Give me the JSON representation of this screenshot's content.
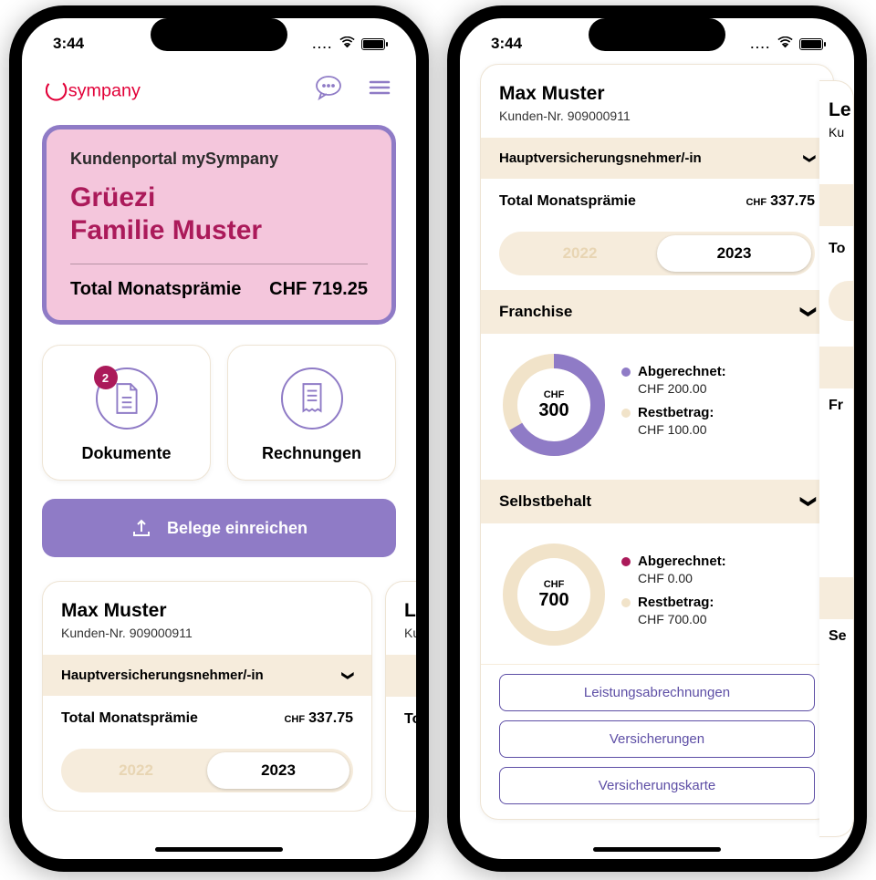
{
  "colors": {
    "violet": "#8f7bc6",
    "cream": "#f1e3c9",
    "wine": "#ab1a5a"
  },
  "status": {
    "time": "3:44",
    "dots": "...."
  },
  "brand": "sympany",
  "hero": {
    "portal": "Kundenportal mySympany",
    "greet1": "Grüezi",
    "greet2": "Familie Muster",
    "premium_label": "Total Monatsprämie",
    "premium_value": "CHF 719.25"
  },
  "tiles": {
    "docs": {
      "label": "Dokumente",
      "badge": "2"
    },
    "bills": {
      "label": "Rechnungen"
    }
  },
  "submit_label": "Belege einreichen",
  "member": {
    "name": "Max Muster",
    "customer_no_label": "Kunden-Nr. 909000911",
    "role": "Hauptversicherungsnehmer/-in",
    "premium_label": "Total Monatsprämie",
    "premium_currency": "CHF",
    "premium_value": "337.75",
    "years": {
      "prev": "2022",
      "current": "2023"
    }
  },
  "peek": {
    "name": "Le",
    "no": "Ku",
    "prem": "To"
  },
  "franchise": {
    "title": "Franchise",
    "currency": "CHF",
    "total": "300",
    "settled_label": "Abgerechnet:",
    "settled_value": "CHF 200.00",
    "rest_label": "Restbetrag:",
    "rest_value": "CHF 100.00"
  },
  "deductible": {
    "title": "Selbstbehalt",
    "currency": "CHF",
    "total": "700",
    "settled_label": "Abgerechnet:",
    "settled_value": "CHF 0.00",
    "rest_label": "Restbetrag:",
    "rest_value": "CHF 700.00"
  },
  "buttons": {
    "b1": "Leistungsabrechnungen",
    "b2": "Versicherungen",
    "b3": "Versicherungskarte"
  },
  "peek2": {
    "name": "Le",
    "no": "Ku",
    "fr": "Fr",
    "sb": "Se",
    "prem": "To"
  }
}
